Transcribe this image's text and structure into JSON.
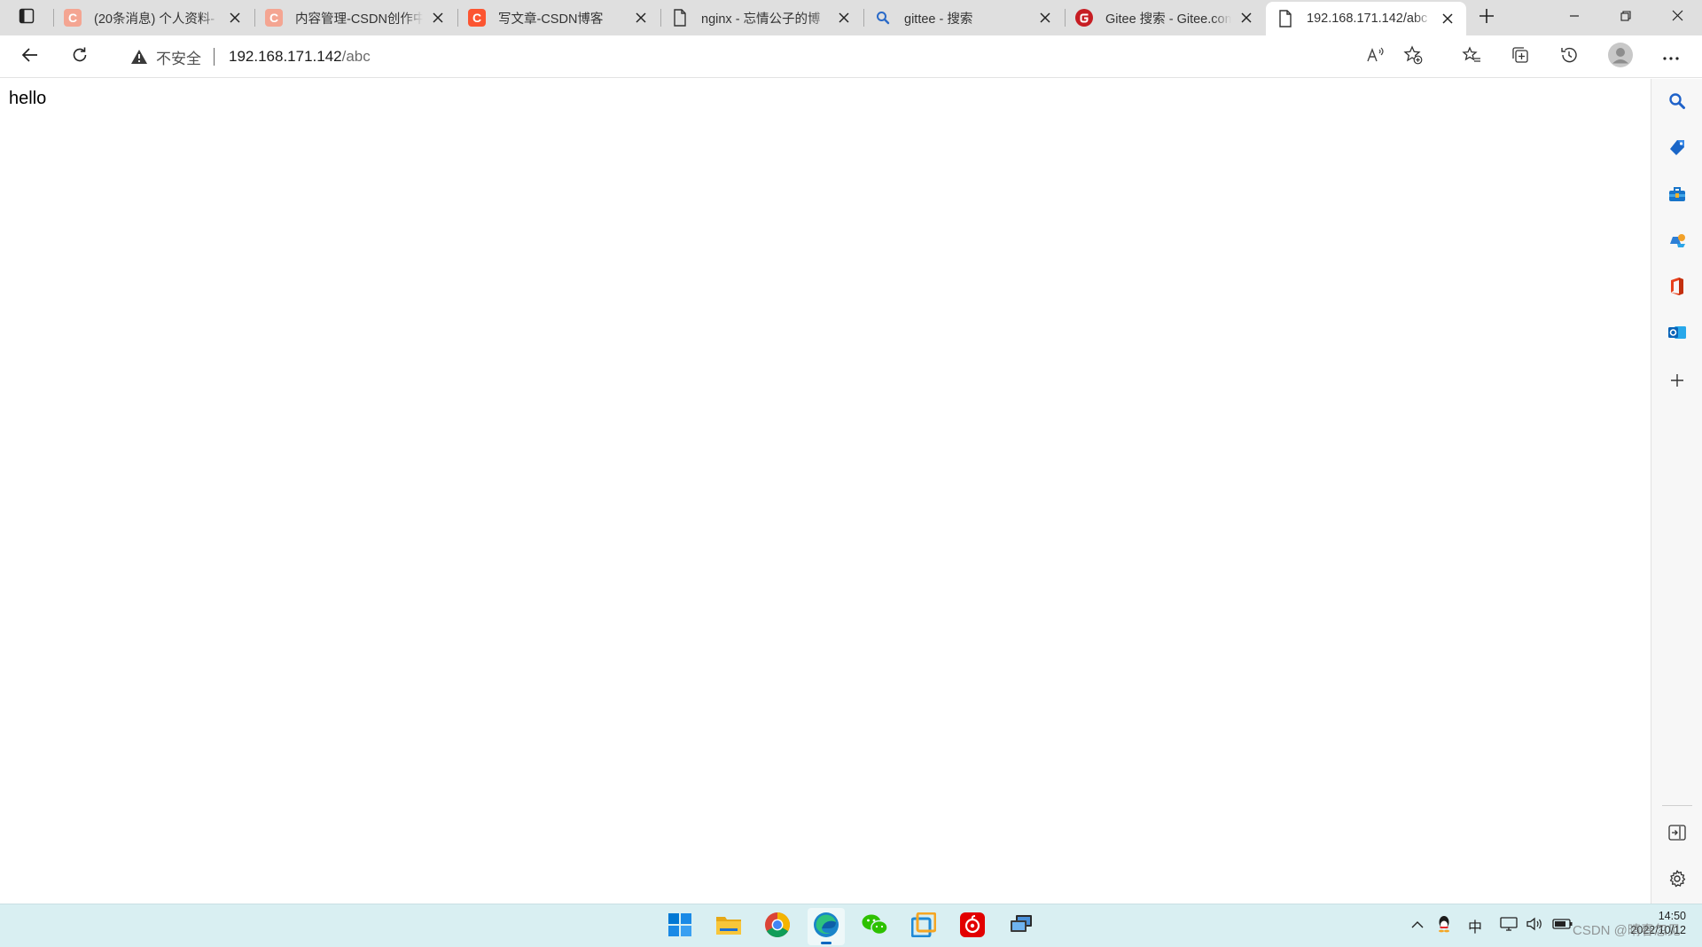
{
  "browser": {
    "tabs": [
      {
        "title": "(20条消息) 个人资料-",
        "icon": "csdn-icon",
        "color": "#fc5531",
        "faded": true
      },
      {
        "title": "内容管理-CSDN创作中",
        "icon": "csdn-icon",
        "color": "#fc5531",
        "faded": true
      },
      {
        "title": "写文章-CSDN博客",
        "icon": "csdn-icon",
        "color": "#fc5531",
        "faded": false
      },
      {
        "title": "nginx - 忘情公子的博",
        "icon": "page-icon"
      },
      {
        "title": "gittee - 搜索",
        "icon": "search-icon"
      },
      {
        "title": "Gitee 搜索 - Gitee.com",
        "icon": "gitee-icon",
        "color": "#c71d23"
      },
      {
        "title": "192.168.171.142/abc",
        "icon": "page-icon",
        "active": true
      }
    ],
    "address": {
      "security_label": "不安全",
      "host": "192.168.171.142",
      "path": "/abc"
    }
  },
  "page": {
    "text": "hello"
  },
  "sidebar": {
    "items": [
      "search-icon",
      "shopping-tag-icon",
      "tools-icon",
      "games-icon",
      "office-icon",
      "outlook-icon",
      "add-icon"
    ],
    "bottom": [
      "hide-sidebar-icon",
      "settings-icon"
    ]
  },
  "taskbar": {
    "apps": [
      "start-icon",
      "file-explorer-icon",
      "chrome-icon",
      "edge-icon",
      "wechat-icon",
      "vmware-icon",
      "netease-music-icon",
      "remote-desktop-icon"
    ],
    "tray": {
      "ime": "中",
      "time": "14:50",
      "date": "2022/10/12"
    },
    "watermark": "CSDN @晴春忽见"
  },
  "colors": {
    "tabstrip_bg": "#dfdfdf",
    "taskbar_bg": "#d9eff2",
    "edge_blue": "#0067c0"
  }
}
